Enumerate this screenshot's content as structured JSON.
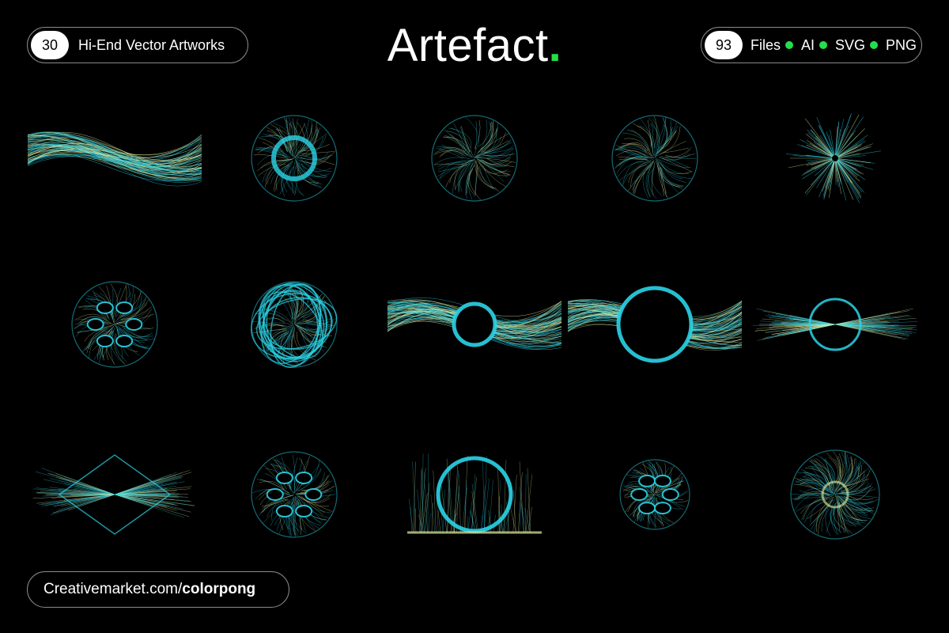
{
  "header": {
    "left_badge": {
      "count": "30",
      "label": "Hi-End Vector Artworks"
    },
    "title": "Artefact",
    "title_period": ".",
    "right_badge": {
      "count": "93",
      "files_label": "Files",
      "formats": [
        "AI",
        "SVG",
        "PNG"
      ]
    }
  },
  "footer": {
    "url_prefix": "Creativemarket.com/",
    "url_handle": "colorpong"
  },
  "colors": {
    "accent_green": "#22e04a",
    "background": "#000000",
    "art_cyan": "#2ad4e8",
    "art_yellow": "#e8f0a0"
  },
  "artworks": [
    {
      "name": "wave-splash",
      "shape": "splash"
    },
    {
      "name": "ring-circle",
      "shape": "ring"
    },
    {
      "name": "starburst-circle",
      "shape": "star"
    },
    {
      "name": "radial-flower-circle",
      "shape": "star"
    },
    {
      "name": "hexagon-flower",
      "shape": "flower"
    },
    {
      "name": "cell-circle",
      "shape": "cells"
    },
    {
      "name": "loop-sphere",
      "shape": "loops"
    },
    {
      "name": "wave-ring-small",
      "shape": "waveRing"
    },
    {
      "name": "wave-ring-large",
      "shape": "waveRingBig"
    },
    {
      "name": "horizontal-sphere",
      "shape": "hSphere"
    },
    {
      "name": "diamond-burst",
      "shape": "diamond"
    },
    {
      "name": "cell-circle-2",
      "shape": "cells"
    },
    {
      "name": "arch-ring",
      "shape": "arch"
    },
    {
      "name": "small-cell-circle",
      "shape": "cellsSmall"
    },
    {
      "name": "hairy-ring",
      "shape": "hairy"
    }
  ]
}
